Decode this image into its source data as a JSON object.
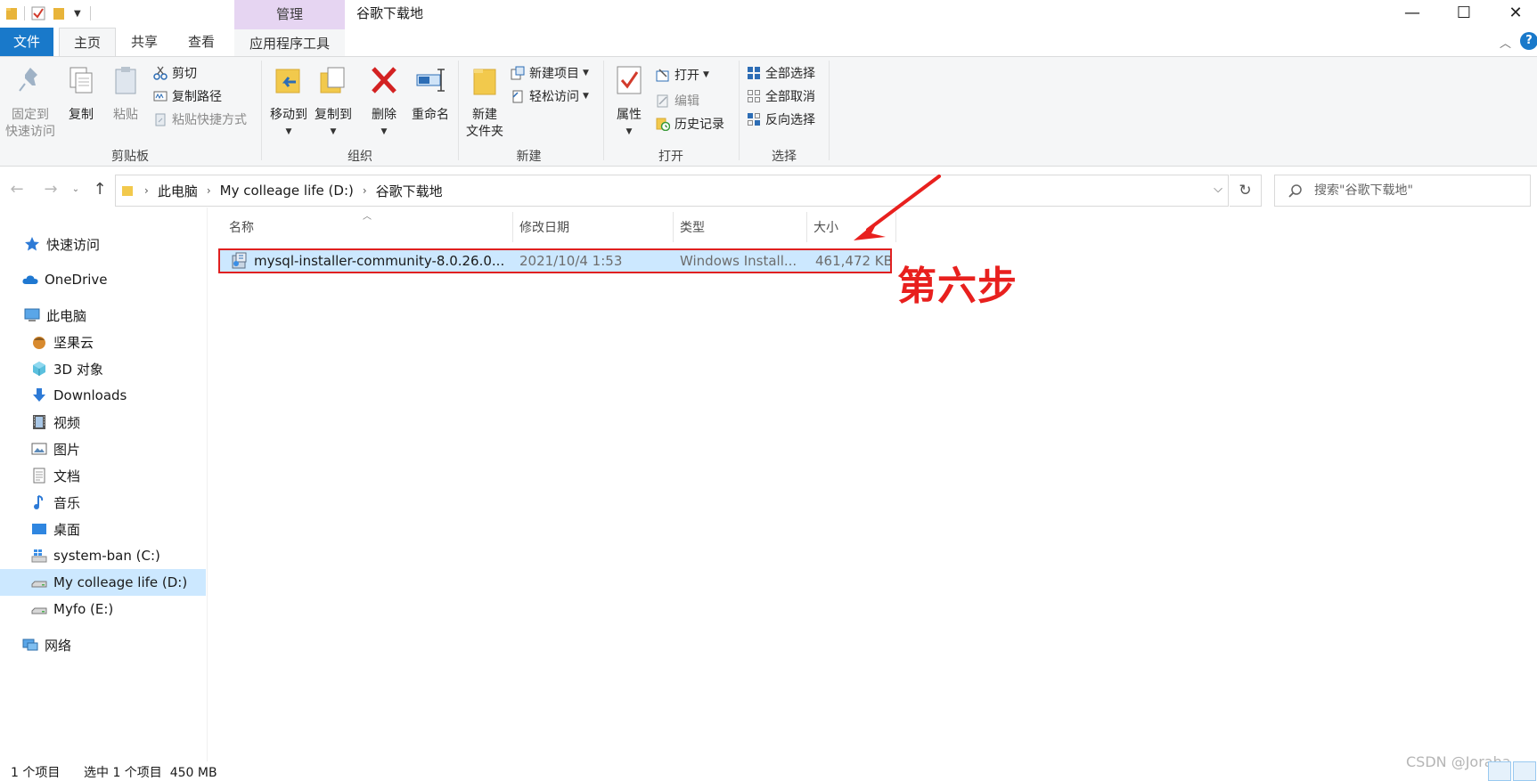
{
  "window": {
    "title": "谷歌下载地",
    "contextual_tab": "管理"
  },
  "ribbon_tabs": {
    "file": "文件",
    "home": "主页",
    "share": "共享",
    "view": "查看",
    "app_tools": "应用程序工具"
  },
  "ribbon": {
    "clipboard": {
      "label": "剪贴板",
      "pin_line1": "固定到",
      "pin_line2": "快速访问",
      "copy": "复制",
      "paste": "粘贴",
      "cut": "剪切",
      "copy_path": "复制路径",
      "paste_shortcut": "粘贴快捷方式"
    },
    "organize": {
      "label": "组织",
      "move_to": "移动到",
      "copy_to": "复制到",
      "delete": "删除",
      "rename": "重命名"
    },
    "new": {
      "label": "新建",
      "new_folder_line1": "新建",
      "new_folder_line2": "文件夹",
      "new_item": "新建项目",
      "easy_access": "轻松访问"
    },
    "open": {
      "label": "打开",
      "properties": "属性",
      "open": "打开",
      "edit": "编辑",
      "history": "历史记录"
    },
    "select": {
      "label": "选择",
      "select_all": "全部选择",
      "select_none": "全部取消",
      "invert": "反向选择"
    }
  },
  "address": {
    "crumbs": [
      "此电脑",
      "My colleage life (D:)",
      "谷歌下载地"
    ],
    "search_placeholder": "搜索\"谷歌下载地\""
  },
  "sidebar": {
    "items": [
      {
        "label": "快速访问",
        "icon": "star-icon"
      },
      {
        "label": "OneDrive",
        "icon": "cloud-icon"
      },
      {
        "label": "此电脑",
        "icon": "computer-icon"
      },
      {
        "label": "坚果云",
        "icon": "nut-icon"
      },
      {
        "label": "3D 对象",
        "icon": "cube-icon"
      },
      {
        "label": "Downloads",
        "icon": "download-icon"
      },
      {
        "label": "视频",
        "icon": "video-icon"
      },
      {
        "label": "图片",
        "icon": "picture-icon"
      },
      {
        "label": "文档",
        "icon": "document-icon"
      },
      {
        "label": "音乐",
        "icon": "music-icon"
      },
      {
        "label": "桌面",
        "icon": "desktop-icon"
      },
      {
        "label": "system-ban (C:)",
        "icon": "windows-drive-icon"
      },
      {
        "label": "My colleage life (D:)",
        "icon": "drive-icon"
      },
      {
        "label": "Myfo (E:)",
        "icon": "drive-icon"
      },
      {
        "label": "网络",
        "icon": "network-icon"
      }
    ]
  },
  "columns": {
    "name": "名称",
    "modified": "修改日期",
    "type": "类型",
    "size": "大小"
  },
  "files": [
    {
      "name": "mysql-installer-community-8.0.26.0....",
      "modified": "2021/10/4 1:53",
      "type": "Windows Install...",
      "size": "461,472 KB"
    }
  ],
  "annotation": {
    "text": "第六步",
    "color": "#e8201e"
  },
  "status": {
    "item_count": "1 个项目",
    "selection": "选中 1 个项目  450 MB"
  },
  "watermark": "CSDN @Joraha",
  "colors": {
    "file_tab": "#1979ca",
    "contextual_tab": "#e6d5f2",
    "selection": "#cce8ff",
    "highlight_box": "#e02020"
  }
}
